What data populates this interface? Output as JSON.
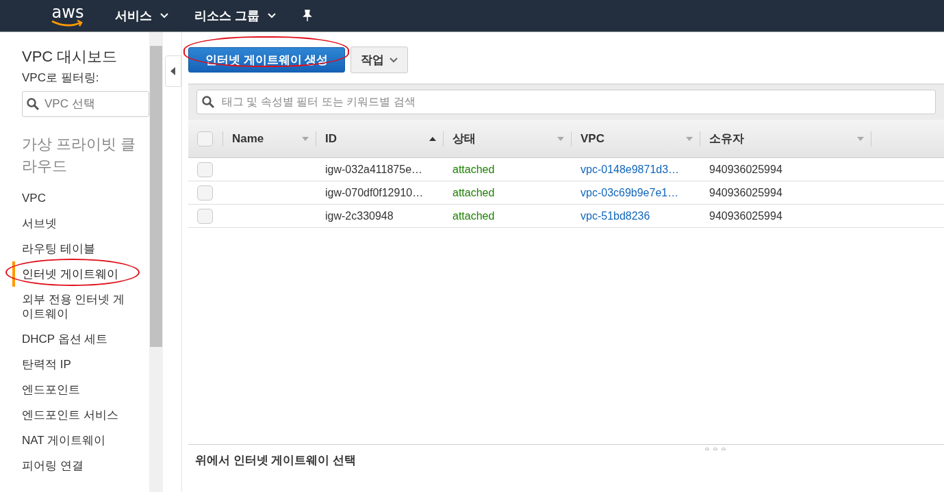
{
  "top_nav": {
    "logo": "aws",
    "menus": [
      {
        "label": "서비스"
      },
      {
        "label": "리소스 그룹"
      }
    ]
  },
  "sidebar": {
    "title": "VPC 대시보드",
    "filter_label": "VPC로 필터링:",
    "filter": {
      "placeholder": "VPC 선택"
    },
    "section": "가상 프라이빗 클라우드",
    "items": [
      {
        "label": "VPC",
        "selected": false
      },
      {
        "label": "서브넷",
        "selected": false
      },
      {
        "label": "라우팅 테이블",
        "selected": false
      },
      {
        "label": "인터넷 게이트웨이",
        "selected": true
      },
      {
        "label": "외부 전용 인터넷 게이트웨이",
        "selected": false
      },
      {
        "label": "DHCP 옵션 세트",
        "selected": false
      },
      {
        "label": "탄력적 IP",
        "selected": false
      },
      {
        "label": "엔드포인트",
        "selected": false
      },
      {
        "label": "엔드포인트 서비스",
        "selected": false
      },
      {
        "label": "NAT 게이트웨이",
        "selected": false
      },
      {
        "label": "피어링 연결",
        "selected": false
      }
    ]
  },
  "toolbar": {
    "create_button": "인터넷 게이트웨이 생성",
    "actions_button": "작업"
  },
  "search": {
    "placeholder": "태그 및 속성별 필터 또는 키워드별 검색"
  },
  "table": {
    "select_all": {
      "checked": false
    },
    "columns": [
      {
        "label": "Name",
        "sorted": false
      },
      {
        "label": "ID",
        "sorted": true
      },
      {
        "label": "상태",
        "sorted": false
      },
      {
        "label": "VPC",
        "sorted": false
      },
      {
        "label": "소유자",
        "sorted": false
      }
    ],
    "rows": [
      {
        "checked": false,
        "id": "igw-032a411875e…",
        "state": "attached",
        "vpc": "vpc-0148e9871d3…",
        "owner": "940936025994"
      },
      {
        "checked": false,
        "id": "igw-070df0f12910…",
        "state": "attached",
        "vpc": "vpc-03c69b9e7e1…",
        "owner": "940936025994"
      },
      {
        "checked": false,
        "id": "igw-2c330948",
        "state": "attached",
        "vpc": "vpc-51bd8236",
        "owner": "940936025994"
      }
    ]
  },
  "detail_panel": {
    "message": "위에서 인터넷 게이트웨이 선택"
  }
}
